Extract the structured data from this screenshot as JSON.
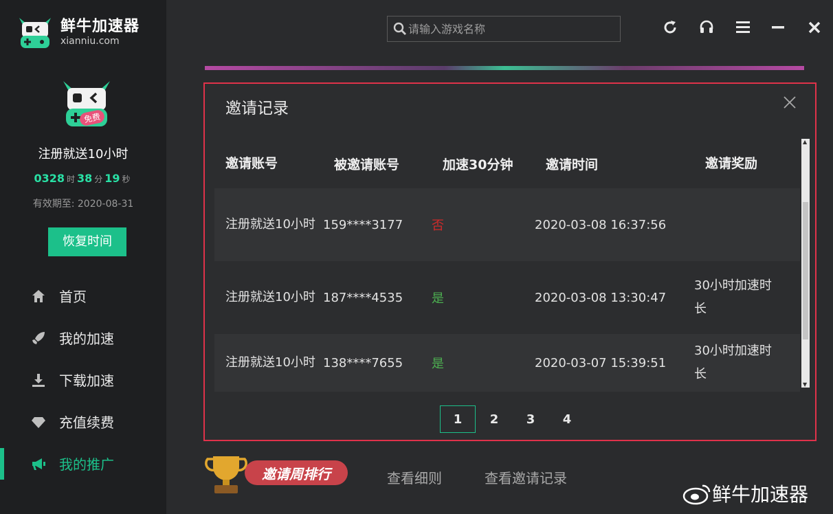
{
  "app": {
    "name": "鲜牛加速器",
    "domain": "xianniu.com"
  },
  "user": {
    "badge": "免费",
    "promo_text": "注册就送10小时",
    "time_hours": "0328",
    "time_hours_unit": "时",
    "time_minutes": "38",
    "time_minutes_unit": "分",
    "time_seconds": "19",
    "time_seconds_unit": "秒",
    "expire": "有效期至: 2020-08-31",
    "restore_button": "恢复时间"
  },
  "nav": {
    "items": [
      {
        "label": "首页",
        "icon": "home-icon"
      },
      {
        "label": "我的加速",
        "icon": "rocket-icon"
      },
      {
        "label": "下载加速",
        "icon": "download-icon"
      },
      {
        "label": "充值续费",
        "icon": "diamond-icon"
      },
      {
        "label": "我的推广",
        "icon": "megaphone-icon",
        "active": true
      }
    ]
  },
  "search": {
    "placeholder": "请输入游戏名称"
  },
  "modal": {
    "title": "邀请记录",
    "columns": [
      "邀请账号",
      "被邀请账号",
      "加速30分钟",
      "邀请时间",
      "邀请奖励"
    ],
    "rows": [
      {
        "inviter": "注册就送10小时",
        "invitee": "159****3177",
        "speed": "否",
        "time": "2020-03-08 16:37:56",
        "reward": ""
      },
      {
        "inviter": "注册就送10小时",
        "invitee": "187****4535",
        "speed": "是",
        "time": "2020-03-08 13:30:47",
        "reward": "30小时加速时长"
      },
      {
        "inviter": "注册就送10小时",
        "invitee": "138****7655",
        "speed": "是",
        "time": "2020-03-07 15:39:51",
        "reward": "30小时加速时长"
      }
    ],
    "pages": [
      "1",
      "2",
      "3",
      "4"
    ],
    "current_page": "1"
  },
  "bottom": {
    "rank_label": "邀请周排行",
    "rules_link": "查看细则",
    "records_link": "查看邀请记录"
  },
  "watermark": "鲜牛加速器",
  "colors": {
    "accent": "#1cc08a",
    "danger_border": "#e0324a",
    "no": "#d12a2a",
    "yes": "#4caf50"
  }
}
